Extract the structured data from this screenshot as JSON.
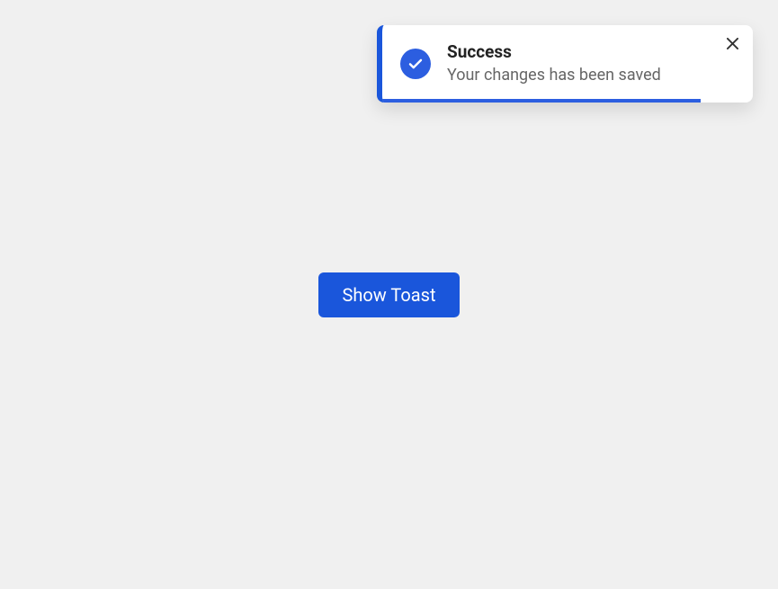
{
  "colors": {
    "primary": "#1a56db",
    "accent": "#2c5ee0",
    "background": "#f0f0f0",
    "toastBackground": "#ffffff"
  },
  "button": {
    "label": "Show Toast"
  },
  "toast": {
    "icon": "check-icon",
    "title": "Success",
    "message": "Your changes has been saved"
  }
}
